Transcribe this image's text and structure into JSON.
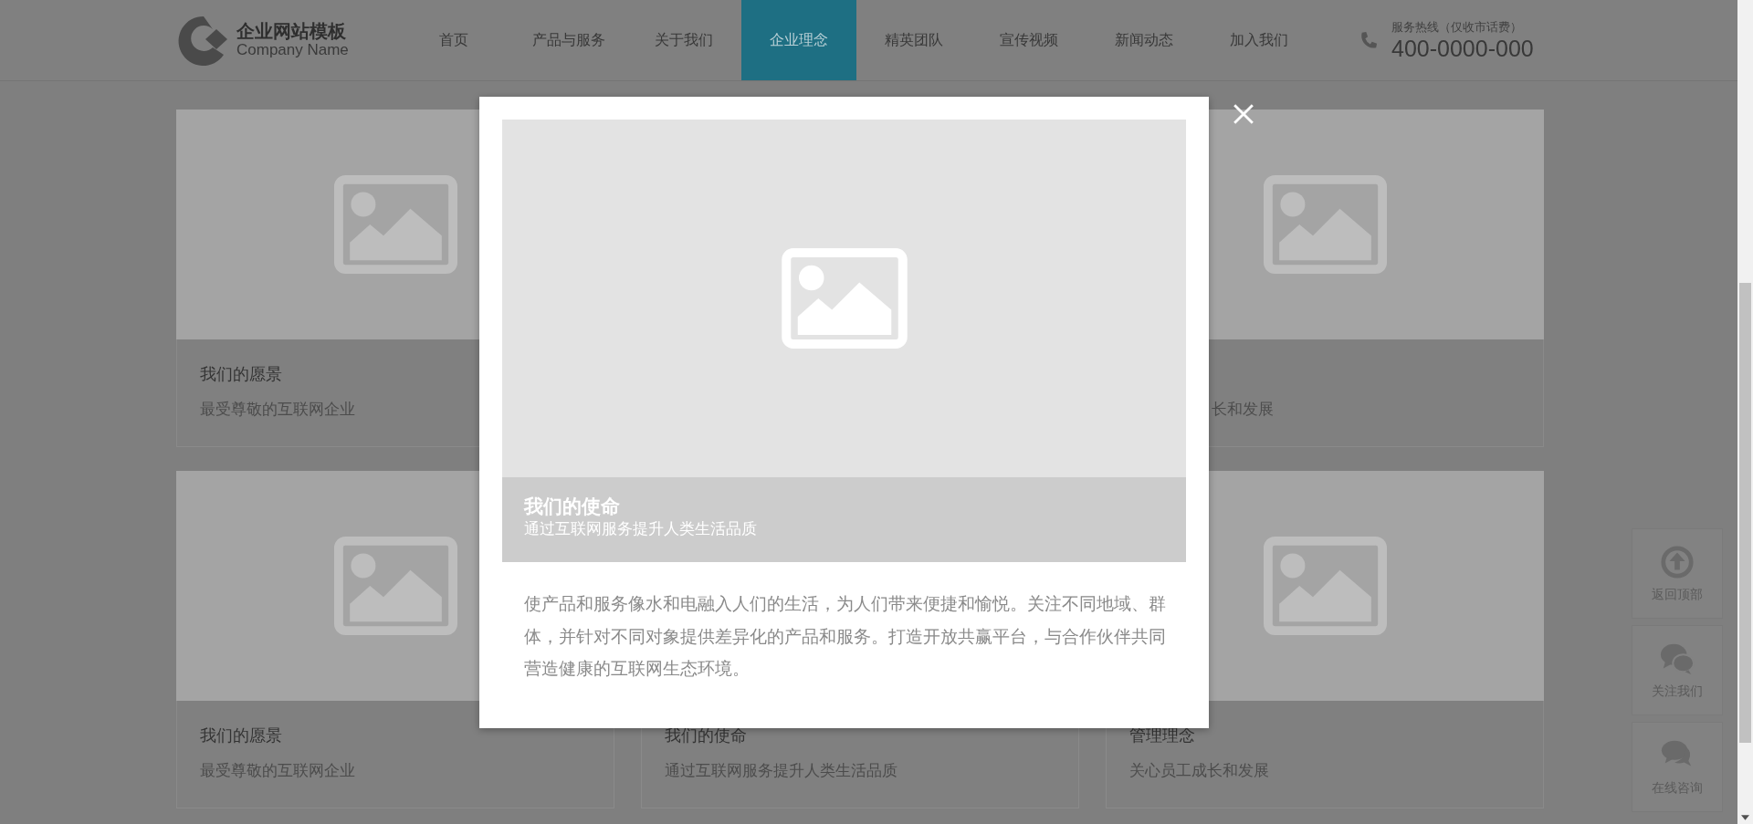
{
  "header": {
    "logo": {
      "title": "企业网站模板",
      "subtitle": "Company Name"
    },
    "nav": [
      {
        "label": "首页",
        "selected": false
      },
      {
        "label": "产品与服务",
        "selected": false
      },
      {
        "label": "关于我们",
        "selected": false
      },
      {
        "label": "企业理念",
        "selected": true
      },
      {
        "label": "精英团队",
        "selected": false
      },
      {
        "label": "宣传视频",
        "selected": false
      },
      {
        "label": "新闻动态",
        "selected": false
      },
      {
        "label": "加入我们",
        "selected": false
      }
    ],
    "hotline": {
      "label": "服务热线（仅收市话费）",
      "number": "400-0000-000"
    }
  },
  "card_rows": [
    {
      "cards": [
        {
          "kind": "full",
          "title": "我们的愿景",
          "text": "最受尊敬的互联网企业"
        },
        {
          "kind": "cut",
          "text": "长和发展"
        }
      ]
    },
    {
      "cards": [
        {
          "kind": "full",
          "title": "我们的愿景",
          "text": "最受尊敬的互联网企业"
        },
        {
          "kind": "full",
          "title": "我们的使命",
          "text": "通过互联网服务提升人类生活品质"
        },
        {
          "kind": "full",
          "title": "管理理念",
          "text": "关心员工成长和发展"
        }
      ]
    }
  ],
  "modal": {
    "caption_title": "我们的使命",
    "caption_text": "通过互联网服务提升人类生活品质",
    "body": "使产品和服务像水和电融入人们的生活，为人们带来便捷和愉悦。关注不同地域、群体，并针对不同对象提供差异化的产品和服务。打造开放共赢平台，与合作伙伴共同营造健康的互联网生态环境。"
  },
  "side_buttons": [
    {
      "kind": "top",
      "label": "返回顶部"
    },
    {
      "kind": "wechat",
      "label": "关注我们"
    },
    {
      "kind": "chat",
      "label": "在线咨询"
    }
  ]
}
